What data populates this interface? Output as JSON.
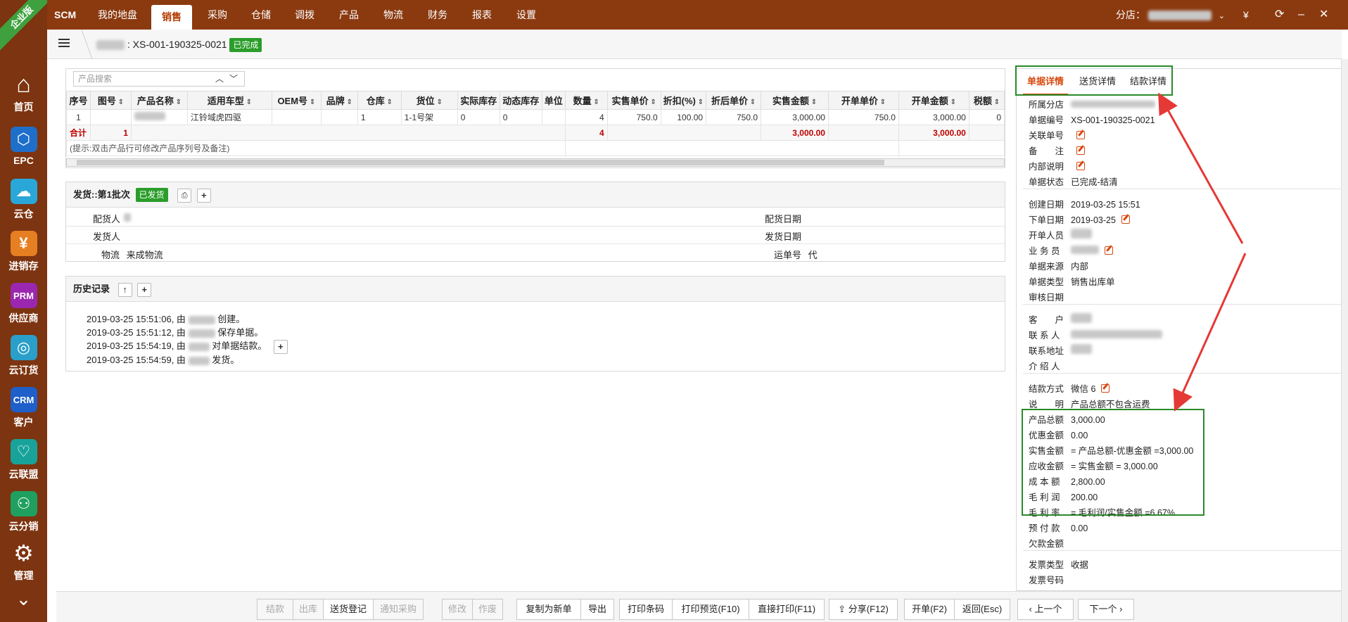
{
  "sidebar": {
    "ribbon": "企业版",
    "items": [
      {
        "label": "首页",
        "icon": "home-icon",
        "color": "#7d3410",
        "glyph": "⌂"
      },
      {
        "label": "EPC",
        "icon": "epc-icon",
        "color": "#1e6fc9",
        "glyph": "⬡"
      },
      {
        "label": "云仓",
        "icon": "cloud-icon",
        "color": "#29a7d8",
        "glyph": "☁"
      },
      {
        "label": "进销存",
        "icon": "yen-icon",
        "color": "#e67e22",
        "glyph": "¥"
      },
      {
        "label": "供应商",
        "icon": "prm-icon",
        "color": "#9b27b0",
        "glyph": "PRM"
      },
      {
        "label": "云订货",
        "icon": "order-icon",
        "color": "#2a9fc9",
        "glyph": "◎"
      },
      {
        "label": "客户",
        "icon": "crm-icon",
        "color": "#1e5fc9",
        "glyph": "CRM"
      },
      {
        "label": "云联盟",
        "icon": "alliance-icon",
        "color": "#18a39a",
        "glyph": "♡"
      },
      {
        "label": "云分销",
        "icon": "distribution-icon",
        "color": "#20a060",
        "glyph": "⚇"
      },
      {
        "label": "管理",
        "icon": "gear-icon",
        "color": "#7d3410",
        "glyph": "⚙"
      }
    ],
    "more_icon": "chevron-down-icon"
  },
  "topbar": {
    "brand": "SCM",
    "nav": [
      "我的地盘",
      "销售",
      "采购",
      "仓储",
      "调拨",
      "产品",
      "物流",
      "财务",
      "报表",
      "设置"
    ],
    "active": "销售",
    "branch_label": "分店：",
    "currency": "¥"
  },
  "crumb": {
    "doc_number": ": XS-001-190325-0021",
    "status": "已完成"
  },
  "product": {
    "search_placeholder": "产品搜索",
    "columns": [
      "序号",
      "图号",
      "产品名称",
      "适用车型",
      "OEM号",
      "品牌",
      "仓库",
      "货位",
      "实际库存",
      "动态库存",
      "单位",
      "数量",
      "实售单价",
      "折扣(%)",
      "折后单价",
      "实售金额",
      "开单单价",
      "开单金额",
      "税额"
    ],
    "rows": [
      {
        "seq": "1",
        "model": "江铃域虎四驱",
        "warehouse": "1",
        "location": "1-1号架",
        "actual_stock": "0",
        "dynamic_stock": "0",
        "qty": "4",
        "price": "750.0",
        "discount": "100.00",
        "disc_price": "750.0",
        "amount": "3,000.00",
        "order_price": "750.0",
        "order_amount": "3,000.00",
        "tax": "0"
      }
    ],
    "total": {
      "label": "合计",
      "count": "1",
      "qty": "4",
      "amount": "3,000.00",
      "order_amount": "3,000.00"
    },
    "hint": "(提示:双击产品行可修改产品序列号及备注)"
  },
  "delivery": {
    "title": "发货::第1批次",
    "status": "已发货",
    "labels": {
      "dispatcher": "配货人",
      "dispatch_date": "配货日期",
      "shipper": "发货人",
      "ship_date": "发货日期",
      "logistics": "物流",
      "logistics_value": "来成物流",
      "waybill": "运单号",
      "waybill_value": "代"
    }
  },
  "history": {
    "title": "历史记录",
    "entries": [
      {
        "time": "2019-03-25 15:51:06, 由",
        "action": "创建。"
      },
      {
        "time": "2019-03-25 15:51:12, 由",
        "action": "保存单据。"
      },
      {
        "time": "2019-03-25 15:54:19, 由",
        "action": "对单据结款。"
      },
      {
        "time": "2019-03-25 15:54:59, 由",
        "action": "发货。"
      }
    ]
  },
  "right_panel": {
    "tabs": [
      "单据详情",
      "送货详情",
      "结款详情"
    ],
    "rows": {
      "branch": "所属分店",
      "doc_no_key": "单据编号",
      "doc_no": "XS-001-190325-0021",
      "related_key": "关联单号",
      "remark_key": "备　　注",
      "internal_key": "内部说明",
      "state_key": "单据状态",
      "state": "已完成-结清",
      "created_key": "创建日期",
      "created": "2019-03-25 15:51",
      "order_date_key": "下单日期",
      "order_date": "2019-03-25",
      "issuer_key": "开单人员",
      "sales_key": "业 务 员",
      "source_key": "单据来源",
      "source": "内部",
      "type_key": "单据类型",
      "type": "销售出库单",
      "audit_key": "审核日期",
      "customer_key": "客　　户",
      "contact_key": "联 系 人",
      "address_key": "联系地址",
      "introducer_key": "介 绍 人",
      "payment_key": "结款方式",
      "payment": "微信 6",
      "note_key": "说　　明",
      "note": "产品总额不包含运费",
      "total_key": "产品总额",
      "total": "3,000.00",
      "discount_key": "优惠金额",
      "discount": "0.00",
      "actual_key": "实售金额",
      "actual": "= 产品总额-优惠金额 =3,000.00",
      "receivable_key": "应收金额",
      "receivable": "= 实售金额 = 3,000.00",
      "cost_key": "成 本 额",
      "cost": "2,800.00",
      "profit_key": "毛 利 润",
      "profit": "200.00",
      "margin_key": "毛 利 率",
      "margin": "= 毛利润/实售金额 =6.67%",
      "prepaid_key": "预 付 款",
      "prepaid": "0.00",
      "arrears_key": "欠款金额",
      "invoice_type_key": "发票类型",
      "invoice_type": "收据",
      "invoice_no_key": "发票号码"
    }
  },
  "toolbar": {
    "buttons": [
      {
        "label": "结款",
        "disabled": true
      },
      {
        "label": "出库",
        "disabled": true
      },
      {
        "label": "送货登记",
        "disabled": false
      },
      {
        "label": "通知采购",
        "disabled": true
      },
      {
        "label": "修改",
        "disabled": true
      },
      {
        "label": "作废",
        "disabled": true
      },
      {
        "label": "复制为新单",
        "disabled": false
      },
      {
        "label": "导出",
        "disabled": false
      },
      {
        "label": "打印条码",
        "disabled": false
      },
      {
        "label": "打印预览(F10)",
        "disabled": false
      },
      {
        "label": "直接打印(F11)",
        "disabled": false
      },
      {
        "label": "分享(F12)",
        "disabled": false
      },
      {
        "label": "开单(F2)",
        "disabled": false
      },
      {
        "label": "返回(Esc)",
        "disabled": false
      },
      {
        "label": "上一个",
        "disabled": false
      },
      {
        "label": "下一个",
        "disabled": false
      }
    ]
  },
  "colors": {
    "accent": "#d9480f",
    "topbar": "#8b3a10",
    "success": "#2a9d2a",
    "annotation": "#e53935"
  }
}
